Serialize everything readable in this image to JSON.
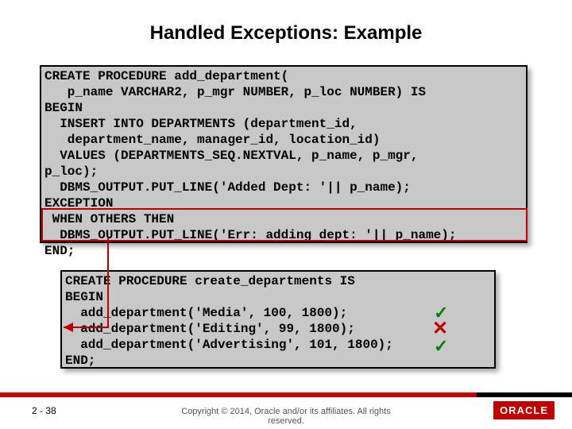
{
  "title": "Handled Exceptions: Example",
  "code1": {
    "l1": "CREATE PROCEDURE add_department(",
    "l2": "   p_name VARCHAR2, p_mgr NUMBER, p_loc NUMBER) IS",
    "l3": "BEGIN",
    "l4": "  INSERT INTO DEPARTMENTS (department_id,",
    "l5": "   department_name, manager_id, location_id)",
    "l6": "  VALUES (DEPARTMENTS_SEQ.NEXTVAL, p_name, p_mgr,",
    "l7": "p_loc);",
    "l8": "  DBMS_OUTPUT.PUT_LINE('Added Dept: '|| p_name);",
    "l9": "EXCEPTION",
    "l10": " WHEN OTHERS THEN",
    "l11": "  DBMS_OUTPUT.PUT_LINE('Err: adding dept: '|| p_name);",
    "l12": "END;"
  },
  "code2": {
    "l1": "CREATE PROCEDURE create_departments IS",
    "l2": "BEGIN",
    "l3": "  add_department('Media', 100, 1800);",
    "l4": "  add_department('Editing', 99, 1800);",
    "l5": "  add_department('Advertising', 101, 1800);",
    "l6": "END;"
  },
  "marks": {
    "check1": "✓",
    "cross": "✕",
    "check2": "✓"
  },
  "footer": {
    "page": "2 - 38",
    "copyright1": "Copyright © 2014, Oracle and/or its affiliates. All rights",
    "copyright2": "reserved.",
    "logo": "ORACLE"
  }
}
